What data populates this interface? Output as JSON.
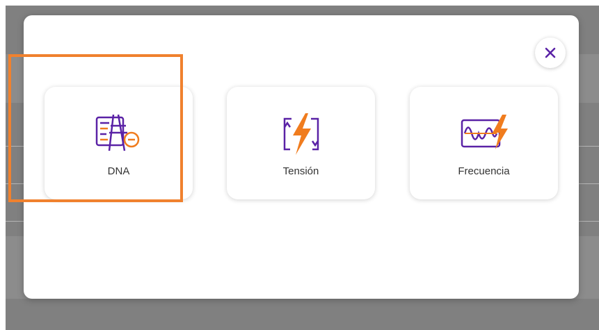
{
  "colors": {
    "accent": "#f07c1e",
    "brand_purple": "#5a22a6",
    "highlight": "#f0812e",
    "backdrop": "#808080"
  },
  "modal": {
    "close_icon": "close-icon",
    "options": [
      {
        "label": "DNA",
        "icon": "dna-document-icon"
      },
      {
        "label": "Tensión",
        "icon": "voltage-lightning-icon"
      },
      {
        "label": "Frecuencia",
        "icon": "frequency-wave-icon"
      }
    ]
  }
}
